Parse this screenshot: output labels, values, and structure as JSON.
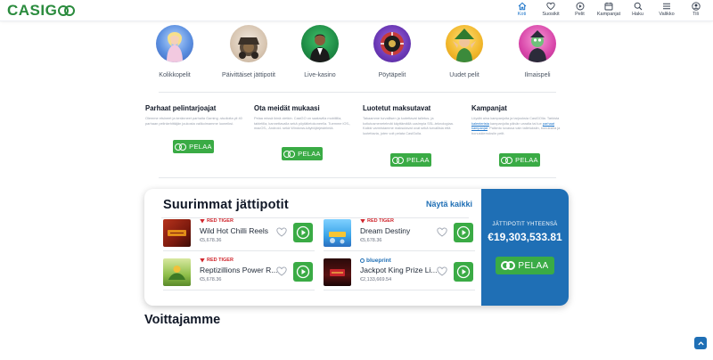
{
  "brand": {
    "logo_text": "CASIGO",
    "logo_prefix": "CASI",
    "logo_suffix": "G"
  },
  "nav": {
    "items": [
      {
        "label": "Koti",
        "icon": "home-icon",
        "active": true
      },
      {
        "label": "Suosikit",
        "icon": "heart-icon"
      },
      {
        "label": "Pelit",
        "icon": "play-circle-icon"
      },
      {
        "label": "Kampanjat",
        "icon": "calendar-icon"
      },
      {
        "label": "Haku",
        "icon": "search-icon"
      },
      {
        "label": "Valikko",
        "icon": "menu-icon"
      },
      {
        "label": "Tili",
        "icon": "account-icon"
      }
    ]
  },
  "categories": [
    {
      "label": "Kolikkopelit"
    },
    {
      "label": "Päivittäiset jättipotit"
    },
    {
      "label": "Live-kasino"
    },
    {
      "label": "Pöytäpelit"
    },
    {
      "label": "Uudet pelit"
    },
    {
      "label": "Ilmaispeli"
    }
  ],
  "info": [
    {
      "title": "Parhaat pelintarjoajat",
      "text": "Olemme etsineet ja keränneet parhaita Gaming -studioita yli 40 parhaan pelinkehittäjän joukosta valikoimamme luoneiksi.",
      "button": "PELAA"
    },
    {
      "title": "Ota meidät mukaasi",
      "text": "Pelaa missä ikinä oletkin. CasiGO on saatavilla mobiililla, tabletilla, kannettavalla sekä pöytätietokoneella. Tuemme iOS-, macOS-, Android- sekä Windows-käyttöjärjestelmiä.",
      "button": "PELAA"
    },
    {
      "title": "Luotetut maksutavat",
      "text": "Takaamme turvallisen ja luotettavat talletus- ja kotiutusmenetelmät käyttämällä uusimpia SSL-teknologiaa. Kaikki varmistamme maksutavat ovat sekä turvallisia että luotettavia, joten voit pelata CasiGolla.",
      "button": "PELAA"
    },
    {
      "title": "Kampanjat",
      "text_before_link": "Löydät aina kampanjoita ja tarjouksia CasiGOlla. Tarkista ",
      "link1": "kalenterista",
      "text_middle": " kampanjoita päivän varalta tai lue ",
      "link2": "parhaat kampanjat",
      "text_after": ". Palkinto luvassa vain talletuksiin, bonuksilla ja bonuskierroksiin pelit.",
      "button": "PELAA"
    }
  ],
  "jackpots": {
    "title": "Suurimmat jättipotit",
    "show_all": "Näytä kaikki",
    "games": [
      {
        "provider": "RED TIGER",
        "name": "Wild Hot Chilli Reels",
        "amount": "€5,678.36"
      },
      {
        "provider": "RED TIGER",
        "name": "Dream Destiny",
        "amount": "€5,678.36"
      },
      {
        "provider": "RED TIGER",
        "name": "Reptizillions Power R...",
        "amount": "€5,678.36"
      },
      {
        "provider": "blueprint",
        "name": "Jackpot King Prize Li...",
        "amount": "€2,133,669.54"
      }
    ],
    "total_label": "JÄTTIPOTIT YHTEENSÄ",
    "total_value": "€19,303,533.81",
    "cta": "PELAA"
  },
  "winners_title": "Voittajamme",
  "colors": {
    "brand_green": "#3aab45",
    "brand_blue": "#1f6fb5",
    "provider_red": "#d0262d"
  }
}
